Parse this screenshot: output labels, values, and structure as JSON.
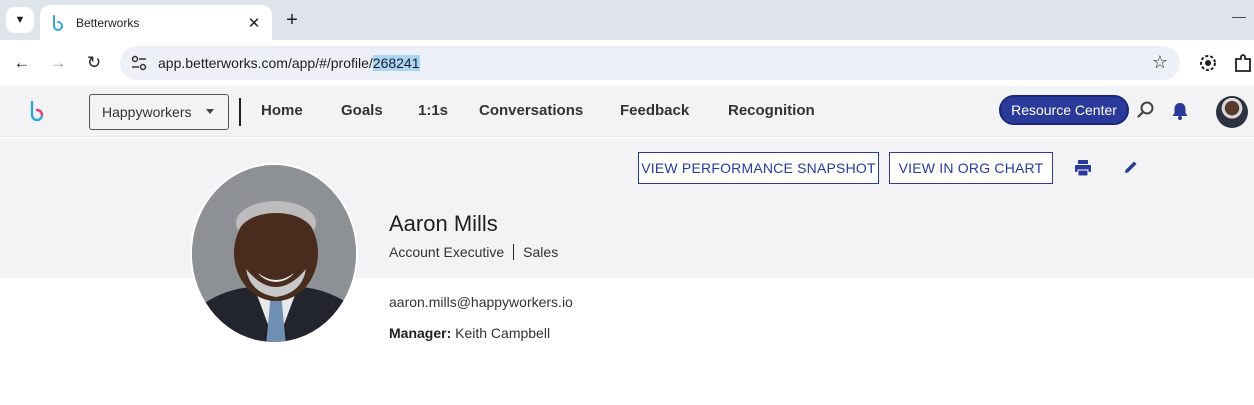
{
  "browser": {
    "tab_title": "Betterworks",
    "tab_close": "✕",
    "new_tab": "+",
    "url_prefix": "app.betterworks.com/app/#/profile/",
    "url_highlight": "268241"
  },
  "appnav": {
    "org_select": "Happyworkers",
    "links": [
      "Home",
      "Goals",
      "1:1s",
      "Conversations",
      "Feedback",
      "Recognition"
    ],
    "resource_center": "Resource Center"
  },
  "profile": {
    "view_snapshot": "VIEW PERFORMANCE SNAPSHOT",
    "view_org_chart": "VIEW IN ORG CHART",
    "name": "Aaron Mills",
    "job_title": "Account Executive",
    "department": "Sales",
    "email": "aaron.mills@happyworkers.io",
    "manager_label": "Manager:",
    "manager_name": "Keith Campbell"
  },
  "colors": {
    "accent": "#2a3a9a",
    "band": "#f3f3f6",
    "url_highlight": "#a9d5f7"
  }
}
